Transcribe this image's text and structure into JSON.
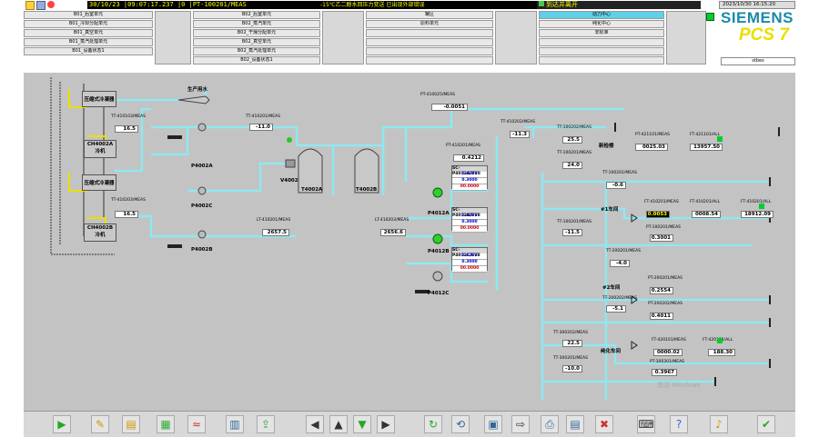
{
  "alarm": {
    "date": "30/10/23",
    "time": "09:07:17.237",
    "flag": "0",
    "tag": "PT-100201/MEAS",
    "message": "-15℃乙二醇水回压力变送 已出现外部错误"
  },
  "ack_banner": "到达并离开",
  "datetime": "2023/10/30 16:15:20",
  "user": "stbes",
  "brand": {
    "siemens": "SIEMENS",
    "pcs7": "PCS 7"
  },
  "area_groups": {
    "col1": [
      "B01_后室单元",
      "B01_冷却分配单元",
      "B01_真空单元",
      "B01_蒸汽处理单元",
      "B01_设备状态1"
    ],
    "col2": [
      "B02_后室单元",
      "B02_蒸汽单元",
      "B02_干燥分配单元",
      "B02_真空单元",
      "B02_蒸汽处理单元",
      "B02_设备状态1"
    ],
    "col3": [
      "罐区",
      "原料单元"
    ],
    "col4": [
      "动力中心",
      "纯化中心",
      "非标准"
    ]
  },
  "process": {
    "chiller1": "压缩式冷凝器",
    "chiller1b": "CH4002A",
    "chiller1c": "冷机",
    "chiller2": "压缩式冷凝器",
    "chiller2b": "CH4002B",
    "chiller2c": "冷机",
    "water_label": "生产用水",
    "tt1": {
      "tag": "TT-410103/MEAS",
      "val": "16.5"
    },
    "tt2": {
      "tag": "TT-410203/MEAS",
      "val": "16.5"
    },
    "tt3": {
      "tag": "TT-410201/MEAS",
      "val": "-11.0"
    },
    "pt1": {
      "tag": "PT-410025/MEAS",
      "val": "-0.0051",
      "unit": "MPa"
    },
    "pt_sub1": "P4002A",
    "pt_sub2": "P4002C",
    "pt_sub3": "P4002B",
    "lt1": {
      "tag": "LT-410201/MEAS",
      "val": "2657.5",
      "unit": "mm"
    },
    "lt2": {
      "tag": "LT-410203/MEAS",
      "val": "2656.6",
      "unit": "mm"
    },
    "tank1": "T4002A",
    "tank2": "T4002B",
    "v4002": "V4002",
    "tt4": {
      "tag": "TT-410202/MEAS",
      "val": "-11.3"
    },
    "pt2": {
      "tag": "PT-410201/MEAS",
      "val": "0.4212",
      "unit": "MPa"
    },
    "pump_a": "P4012A",
    "pump_b": "P4012B",
    "pump_c": "P4012C",
    "fp1": {
      "title": "SC-P4012A/PV8",
      "v1": "0.4212",
      "v2": "0.3000",
      "v3": "00.0000"
    },
    "fp2": {
      "title": "SC-P4012B/PV8",
      "v1": "0.4212",
      "v2": "0.3000",
      "v3": "00.0000"
    },
    "fp3": {
      "title": "SC-P4012C/PV8",
      "v1": "0.4212",
      "v2": "0.3000",
      "v3": "00.0000"
    },
    "new_bldg": "新检楼",
    "new_v1": {
      "tag": "TT-100202/MEAS",
      "val": "25.5"
    },
    "new_v2": {
      "tag": "TT-100201/MEAS",
      "val": "24.0"
    },
    "new_v3": {
      "tag": "PT-421101/MEAS",
      "val": "0025.03",
      "unit": "m³/h"
    },
    "new_v4": {
      "tag": "FT-421101/ALL",
      "val": "13957.50"
    },
    "ws1": "#1车间",
    "ws1_v1": {
      "tag": "TT-100201/MEAS",
      "val": "-0.6"
    },
    "ws1_v2": {
      "tag": "TT-100201/MEAS",
      "val": "-11.5"
    },
    "ws1_v3": {
      "tag": "PT-100201/MEAS",
      "val": "0.3001"
    },
    "ws1_v4": {
      "tag": "FT-410201/MEAS",
      "val": "0.0053"
    },
    "ws1_v5": {
      "tag": "FT-410201/ALL",
      "val": "0008.54"
    },
    "ws1_v6": {
      "tag": "FT-410201/ALL",
      "val": "18912.09"
    },
    "ws2": "#2车间",
    "ws2_v1": {
      "tag": "TT-200201/MEAS",
      "val": "-4.0"
    },
    "ws2_v2": {
      "tag": "PT-200201/MEAS",
      "val": "0.2554"
    },
    "ws2_v3": {
      "tag": "TT-200202/MEAS",
      "val": "-5.1"
    },
    "ws2_v4": {
      "tag": "PT-200202/MEAS",
      "val": "0.4011"
    },
    "pure": "纯化车间",
    "pure_v1": {
      "tag": "TT-300202/MEAS",
      "val": "22.5"
    },
    "pure_v2": {
      "tag": "TT-300201/MEAS",
      "val": "-10.0"
    },
    "pure_v3": {
      "tag": "FT-420101/MEAS",
      "val": "0000.02"
    },
    "pure_v4": {
      "tag": "FT-420101/ALL",
      "val": "188.30"
    },
    "pure_v5": {
      "tag": "PT-300301/MEAS",
      "val": "0.3967"
    }
  },
  "watermark": "激活 Windows"
}
